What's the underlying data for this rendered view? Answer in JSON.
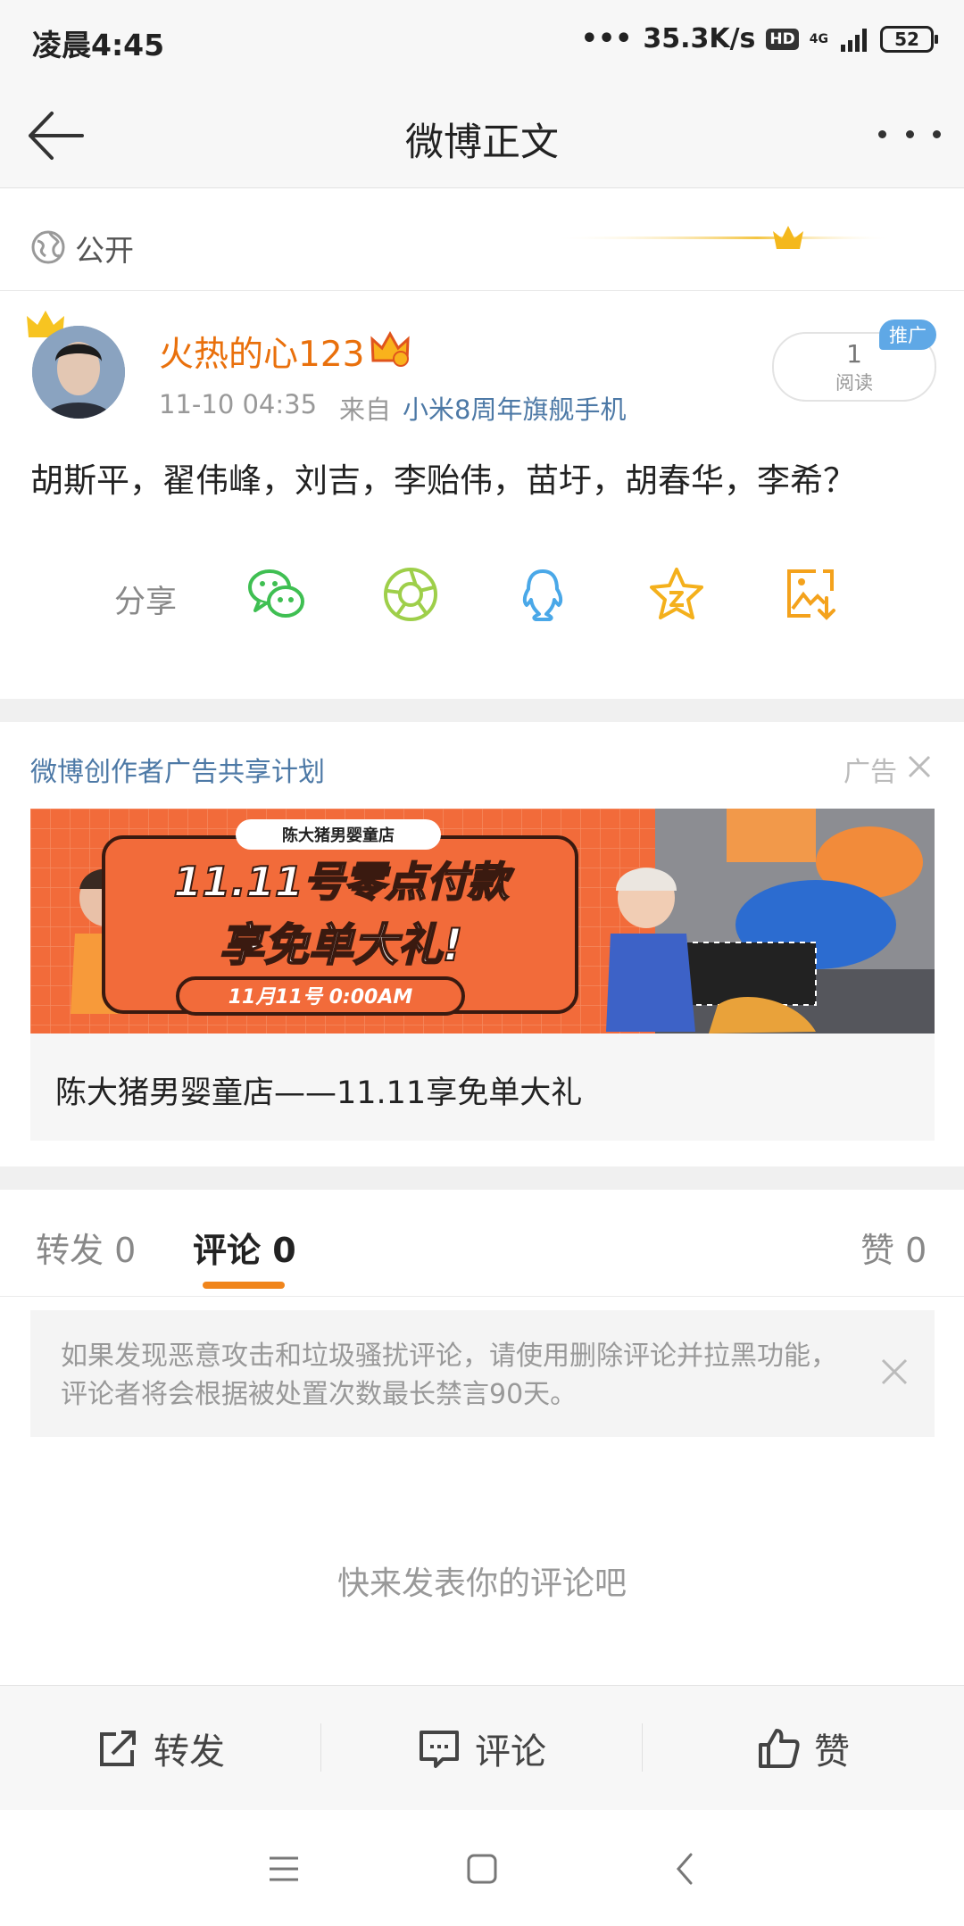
{
  "status_bar": {
    "time": "凌晨4:45",
    "speed": "35.3K/s",
    "hd": "HD",
    "network": "4G",
    "battery": "52"
  },
  "header": {
    "title": "微博正文"
  },
  "post": {
    "visibility": "公开",
    "user_name": "火热的心123",
    "time": "11-10 04:35",
    "from_prefix": "来自",
    "source": "小米8周年旗舰手机",
    "read_count": "1",
    "read_label": "阅读",
    "promo_tag": "推广",
    "text": "胡斯平，翟伟峰，刘吉，李贻伟，苗圩，胡春华，李希？",
    "share_label": "分享",
    "share_icons": [
      "wechat-icon",
      "moments-icon",
      "qq-icon",
      "favorite-star-icon",
      "save-image-icon"
    ]
  },
  "ad": {
    "header": "微博创作者广告共享计划",
    "label": "广告",
    "banner": {
      "store_tag": "陈大猪男婴童店",
      "line1": "11.11号零点付款",
      "line2": "享免单大礼!",
      "time_tag": "11月11号 0:00AM"
    },
    "title": "陈大猪男婴童店——11.11享免单大礼"
  },
  "tabs": {
    "repost": {
      "label": "转发",
      "count": "0"
    },
    "comment": {
      "label": "评论",
      "count": "0"
    },
    "like": {
      "label": "赞",
      "count": "0"
    }
  },
  "notice": {
    "text": "如果发现恶意攻击和垃圾骚扰评论，请使用删除评论并拉黑功能，评论者将会根据被处置次数最长禁言90天。"
  },
  "empty_state": "快来发表你的评论吧",
  "actions": {
    "repost": "转发",
    "comment": "评论",
    "like": "赞"
  },
  "colors": {
    "accent": "#f0851c",
    "username": "#e9700c",
    "link": "#4d79a6"
  }
}
